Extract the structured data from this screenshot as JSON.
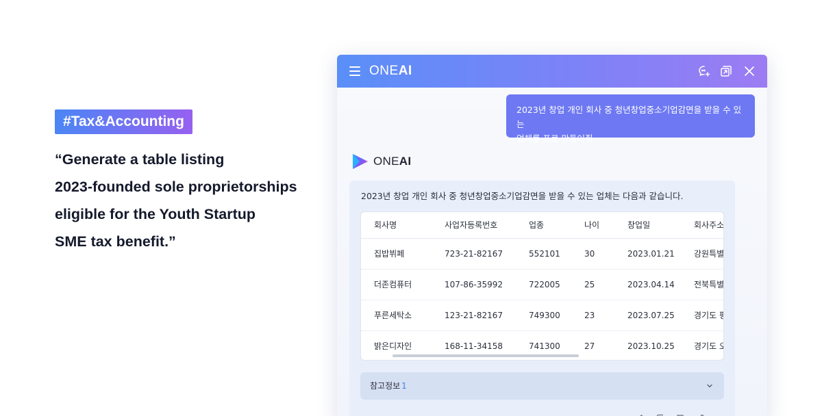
{
  "promo": {
    "tag": "#Tax&Accounting",
    "quote_lines": [
      "“Generate a table listing",
      "2023-founded sole proprietorships",
      "eligible for the Youth Startup",
      "SME tax benefit.”"
    ]
  },
  "window": {
    "brand_prefix": "ONE",
    "brand_suffix": "AI",
    "icons": [
      "menu-icon",
      "new-chat-icon",
      "popout-icon",
      "close-icon"
    ]
  },
  "chat": {
    "user_message": {
      "line1": "2023년 창업 개인 회사 중 청년창업중소기업감면을 받을 수 있는",
      "line2": "업체를 표로 만들어줘"
    },
    "bot": {
      "name_prefix": "ONE",
      "name_suffix": "AI",
      "intro": "2023년 창업 개인 회사 중 청년창업중소기업감면을 받을 수 있는 업체는 다음과 같습니다.",
      "table": {
        "headers": [
          "회사명",
          "사업자등록번호",
          "업종",
          "나이",
          "창업일",
          "회사주소"
        ],
        "rows": [
          [
            "집밥뷔페",
            "723-21-82167",
            "552101",
            "30",
            "2023.01.21",
            "강원특별"
          ],
          [
            "더존컴퓨터",
            "107-86-35992",
            "722005",
            "25",
            "2023.04.14",
            "전북특별"
          ],
          [
            "푸른세탁소",
            "123-21-82167",
            "749300",
            "23",
            "2023.07.25",
            "경기도 평"
          ],
          [
            "밝은디자인",
            "168-11-34158",
            "741300",
            "27",
            "2023.10.25",
            "경기도 오"
          ]
        ]
      },
      "references_label": "참고정보",
      "references_count": "1"
    }
  },
  "colors": {
    "titlebar_start": "#5a8ff8",
    "titlebar_end": "#9c7cf3",
    "user_bubble": "#6d78f2",
    "accent": "#4a7cf0"
  }
}
